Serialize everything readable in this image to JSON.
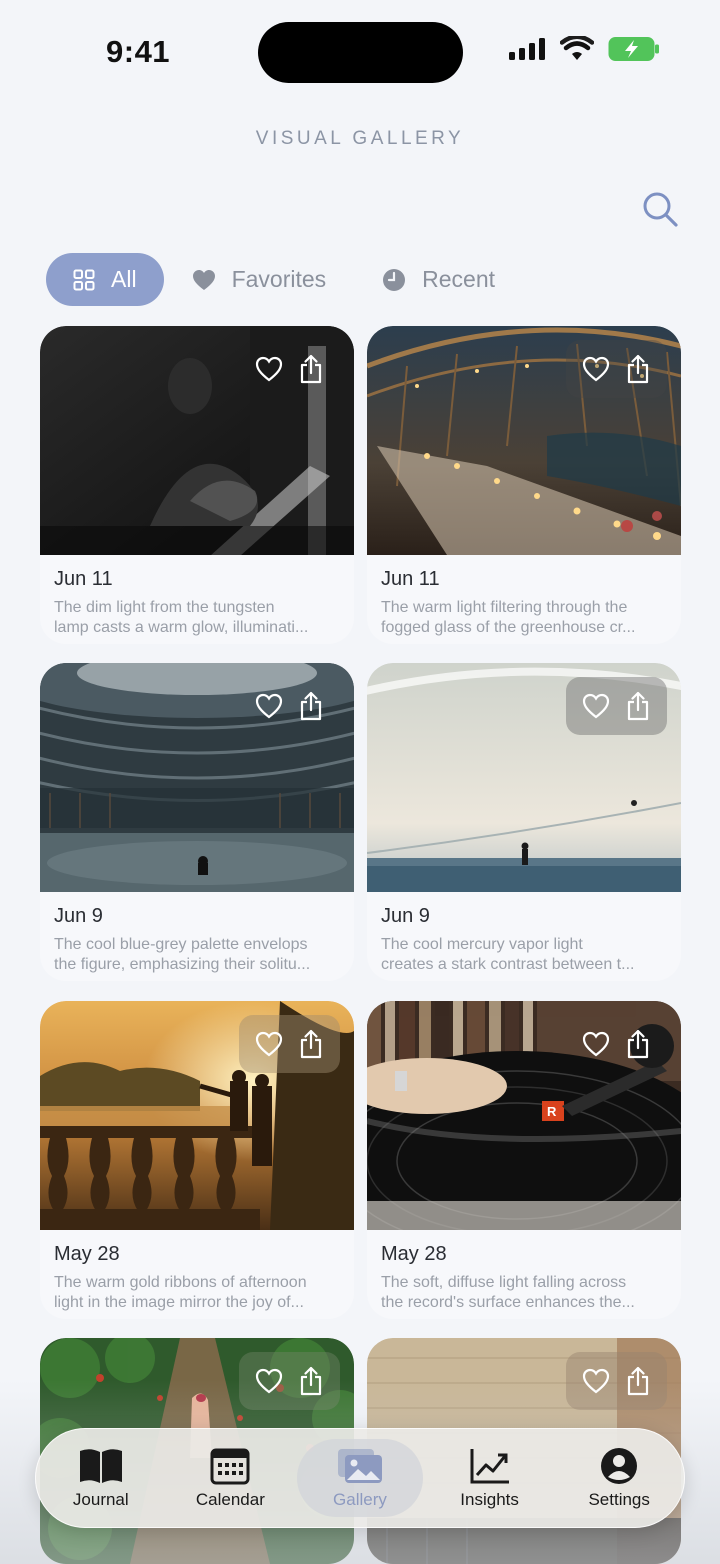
{
  "status_bar": {
    "time": "9:41"
  },
  "header": {
    "title": "VISUAL GALLERY",
    "search_icon": "search-icon"
  },
  "filters": [
    {
      "label": "All",
      "icon": "grid-icon",
      "active": true
    },
    {
      "label": "Favorites",
      "icon": "heart-icon",
      "active": false
    },
    {
      "label": "Recent",
      "icon": "clock-icon",
      "active": false
    }
  ],
  "entries": [
    {
      "date": "Jun 11",
      "line1": "The dim light from the tungsten",
      "line2": "lamp casts a warm glow, illuminati..."
    },
    {
      "date": "Jun 11",
      "line1": "The warm light filtering through the",
      "line2": "fogged glass of the greenhouse cr..."
    },
    {
      "date": "Jun 9",
      "line1": "The cool blue-grey palette envelops",
      "line2": "the figure, emphasizing their solitu..."
    },
    {
      "date": "Jun 9",
      "line1": "The cool mercury vapor light",
      "line2": "creates a stark contrast between t..."
    },
    {
      "date": "May 28",
      "line1": "The warm gold ribbons of afternoon",
      "line2": "light in the image mirror the joy of..."
    },
    {
      "date": "May 28",
      "line1": "The soft, diffuse light falling across",
      "line2": "the record's surface enhances the..."
    }
  ],
  "nav": [
    {
      "label": "Journal",
      "icon": "book-icon",
      "active": false
    },
    {
      "label": "Calendar",
      "icon": "calendar-icon",
      "active": false
    },
    {
      "label": "Gallery",
      "icon": "gallery-icon",
      "active": true
    },
    {
      "label": "Insights",
      "icon": "chart-icon",
      "active": false
    },
    {
      "label": "Settings",
      "icon": "person-icon",
      "active": false
    }
  ]
}
